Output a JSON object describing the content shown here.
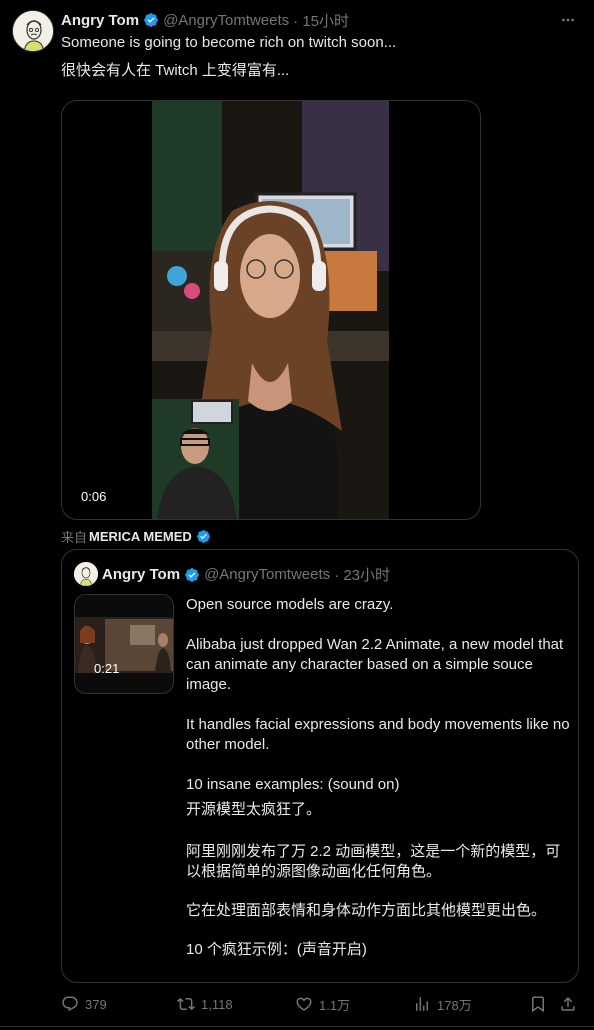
{
  "tweet": {
    "author_name": "Angry Tom",
    "author_handle": "@AngryTomtweets",
    "time": "· 15小时",
    "text_en": "Someone is going to become rich on twitch soon...",
    "text_cn": "很快会有人在 Twitch 上变得富有..."
  },
  "media": {
    "duration": "0:06"
  },
  "from": {
    "prefix": "来自",
    "source": "MERICA MEMED"
  },
  "quote": {
    "author_name": "Angry Tom",
    "author_handle": "@AngryTomtweets",
    "time": "· 23小时",
    "thumb_duration": "0:21",
    "paragraphs": [
      "Open source models are crazy.",
      "Alibaba just dropped Wan 2.2 Animate, a new model that can animate any character based on a simple souce image.",
      "It handles facial expressions and body movements like no other model.",
      "10 insane examples: (sound on)",
      "开源模型太疯狂了。",
      "阿里刚刚发布了万 2.2 动画模型，这是一个新的模型，可以根据简单的源图像动画化任何角色。",
      "它在处理面部表情和身体动作方面比其他模型更出色。",
      "10 个疯狂示例：(声音开启)"
    ]
  },
  "actions": {
    "replies": "379",
    "retweets": "1,118",
    "likes": "1.1万",
    "views": "178万"
  },
  "colors": {
    "verified": "#1d9bf0",
    "muted": "#71767b",
    "border": "#2f3336"
  }
}
